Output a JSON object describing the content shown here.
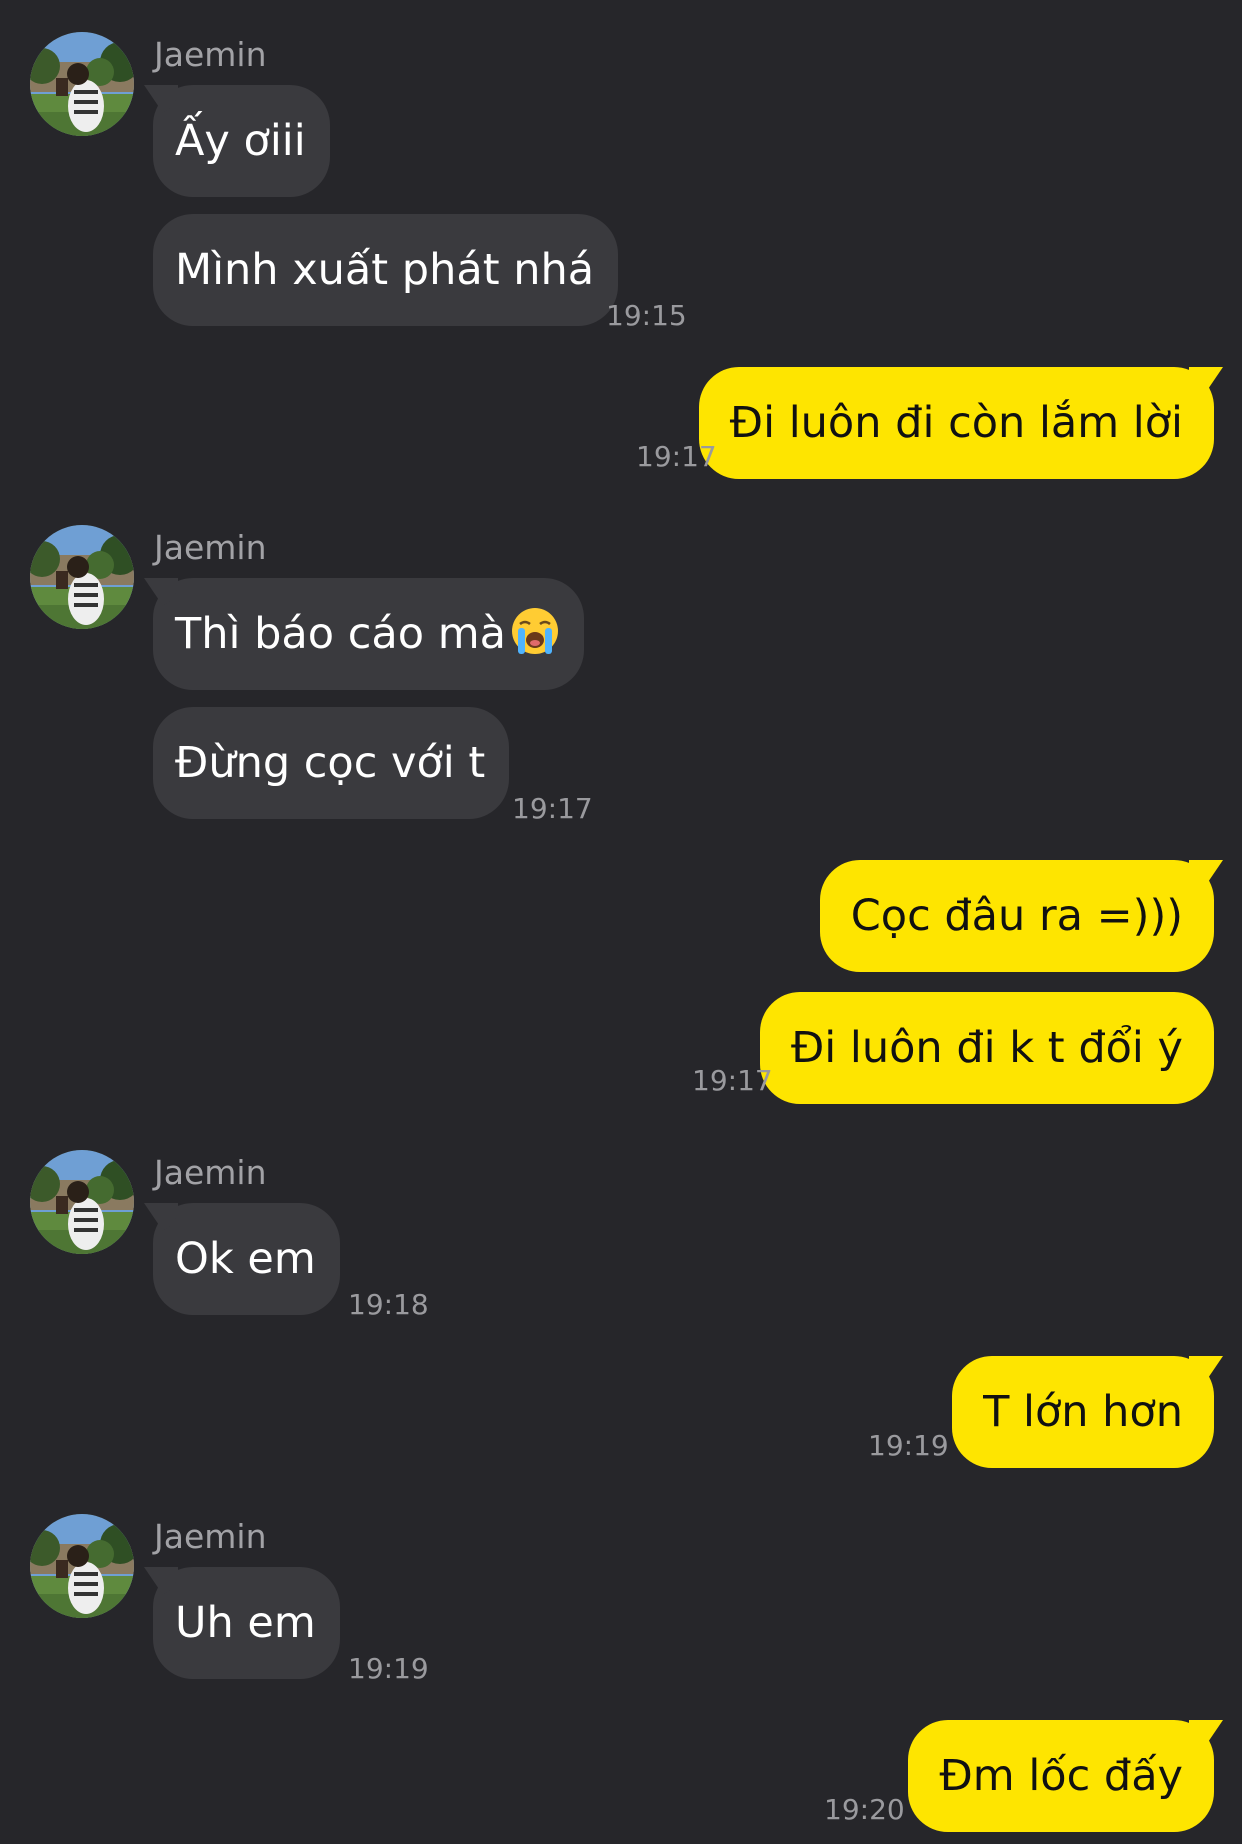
{
  "chat": {
    "contact_name": "Jaemin",
    "groups": [
      {
        "direction": "in",
        "sender": "Jaemin",
        "messages": [
          "Ấy ơiii",
          "Mình xuất phát nhá"
        ],
        "time": "19:15"
      },
      {
        "direction": "out",
        "messages": [
          "Đi luôn đi còn lắm lời"
        ],
        "time": "19:17"
      },
      {
        "direction": "in",
        "sender": "Jaemin",
        "messages": [
          "Thì báo cáo mà",
          "Đừng cọc với t"
        ],
        "emoji": "loudly-crying-face-icon",
        "time": "19:17"
      },
      {
        "direction": "out",
        "messages": [
          "Cọc đâu ra =)))",
          "Đi luôn đi k t đổi ý"
        ],
        "time": "19:17"
      },
      {
        "direction": "in",
        "sender": "Jaemin",
        "messages": [
          "Ok em"
        ],
        "time": "19:18"
      },
      {
        "direction": "out",
        "messages": [
          "T lớn hơn"
        ],
        "time": "19:19"
      },
      {
        "direction": "in",
        "sender": "Jaemin",
        "messages": [
          "Uh em"
        ],
        "time": "19:19"
      },
      {
        "direction": "out",
        "messages": [
          "Đm lốc đấy"
        ],
        "time": "19:20"
      }
    ]
  },
  "colors": {
    "background": "#26262a",
    "incoming_bubble": "#3a3a3e",
    "outgoing_bubble": "#fee500",
    "timestamp": "#9a9a9e"
  }
}
